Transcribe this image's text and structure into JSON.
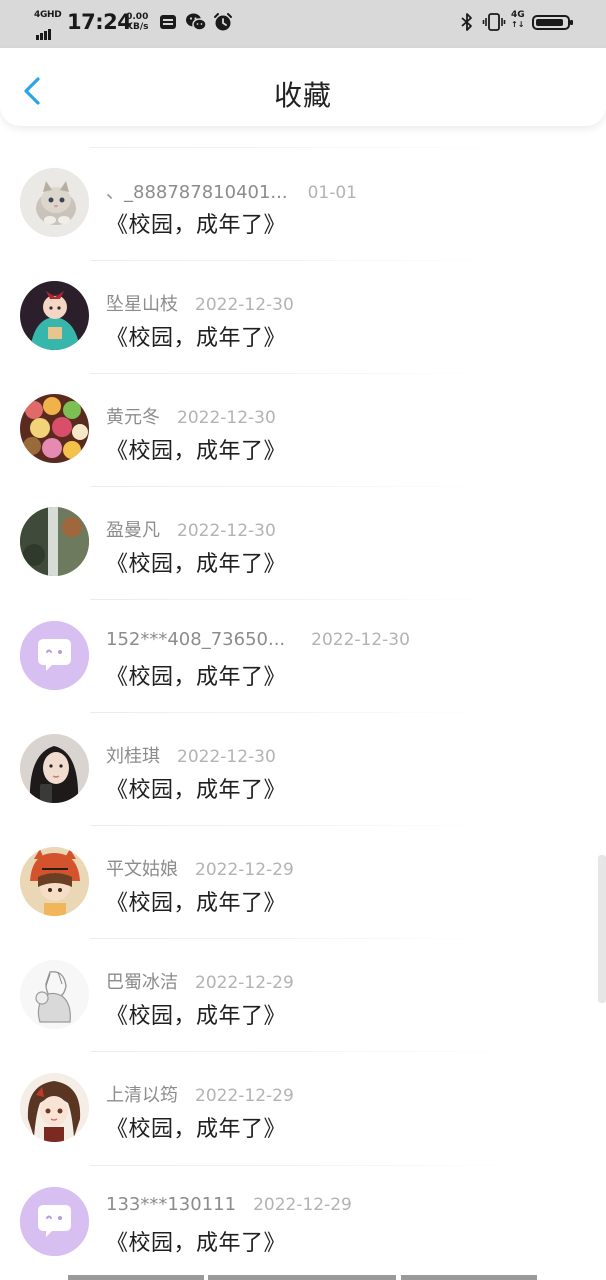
{
  "status_bar": {
    "network": "4GHD",
    "time": "17:24",
    "speed_value": "0.00",
    "speed_unit": "KB/s",
    "right_network": "4G",
    "icons": [
      "sim-card-icon",
      "wechat-icon",
      "alarm-icon",
      "bluetooth-icon",
      "vibrate-icon",
      "battery-icon"
    ]
  },
  "header": {
    "back_icon": "chevron-left-icon",
    "title": "收藏",
    "accent_color": "#2aa3ea"
  },
  "items": [
    {
      "name": "、_888787810401...",
      "date": "01-01",
      "title": "《校园，成年了》",
      "avatar": "kitten-photo"
    },
    {
      "name": "坠星山枝",
      "date": "2022-12-30",
      "title": "《校园，成年了》",
      "avatar": "anime-girl-teal"
    },
    {
      "name": "黄元冬",
      "date": "2022-12-30",
      "title": "《校园，成年了》",
      "avatar": "candy-photo"
    },
    {
      "name": "盈曼凡",
      "date": "2022-12-30",
      "title": "《校园，成年了》",
      "avatar": "waterfall-photo"
    },
    {
      "name": "152***408_73650...",
      "date": "2022-12-30",
      "title": "《校园，成年了》",
      "avatar": "default-chat-avatar"
    },
    {
      "name": "刘桂琪",
      "date": "2022-12-30",
      "title": "《校园，成年了》",
      "avatar": "girl-portrait"
    },
    {
      "name": "平文姑娘",
      "date": "2022-12-29",
      "title": "《校园，成年了》",
      "avatar": "anime-tiger-hat"
    },
    {
      "name": "巴蜀冰洁",
      "date": "2022-12-29",
      "title": "《校园，成年了》",
      "avatar": "sketch-couple"
    },
    {
      "name": "上清以筠",
      "date": "2022-12-29",
      "title": "《校园，成年了》",
      "avatar": "anime-girl-brown"
    },
    {
      "name": "133***130111",
      "date": "2022-12-29",
      "title": "《校园，成年了》",
      "avatar": "default-chat-avatar"
    }
  ]
}
